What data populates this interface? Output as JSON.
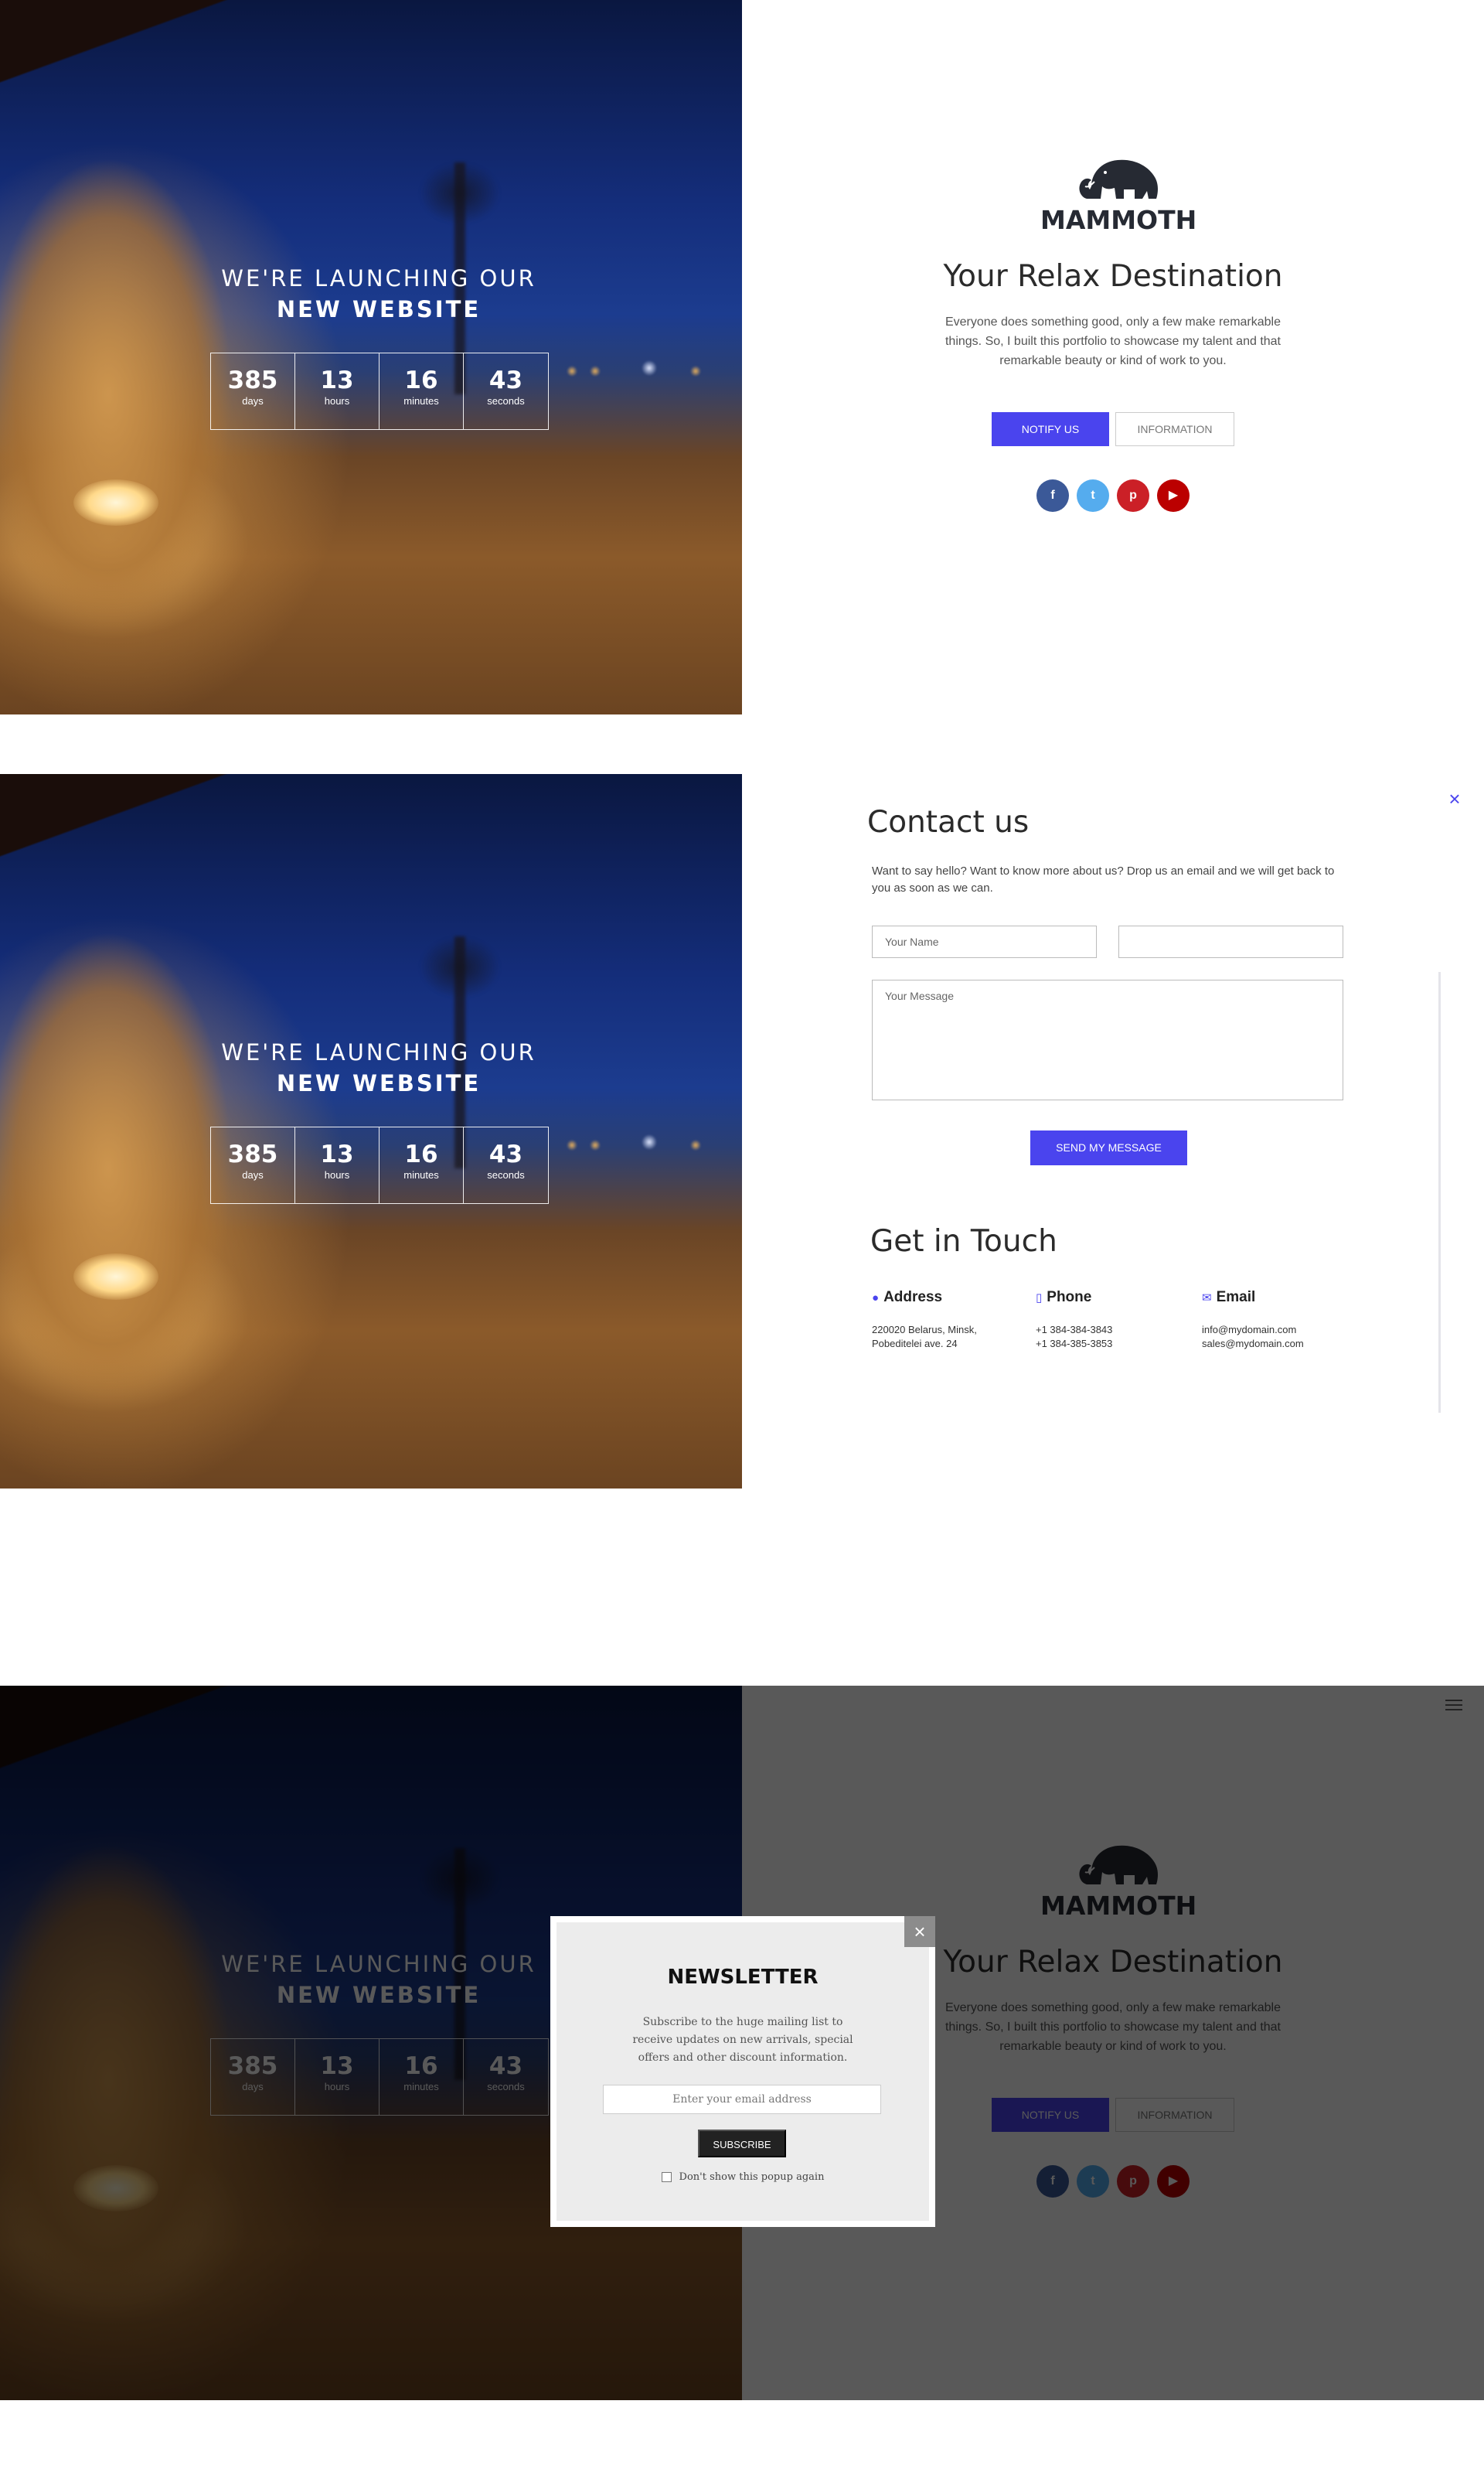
{
  "launch": {
    "line1": "WE'RE LAUNCHING OUR",
    "line2": "NEW WEBSITE"
  },
  "countdown": {
    "days": {
      "value": "385",
      "label": "days"
    },
    "hours": {
      "value": "13",
      "label": "hours"
    },
    "minutes": {
      "value": "16",
      "label": "minutes"
    },
    "seconds": {
      "value": "43",
      "label": "seconds"
    }
  },
  "landing": {
    "logo_text": "MAMMOTH",
    "tagline": "Your Relax Destination",
    "intro": "Everyone does something good, only a few make remarkable things. So, I built this portfolio to showcase my talent and that remarkable beauty or kind of work to you.",
    "notify_label": "NOTIFY US",
    "info_label": "INFORMATION",
    "socials": {
      "facebook": "f",
      "twitter": "t",
      "pinterest": "p",
      "youtube": "▶"
    }
  },
  "contact": {
    "close": "×",
    "title": "Contact us",
    "description": "Want to say hello? Want to know more about us? Drop us an email and we will get back to you as soon as we can.",
    "name_placeholder": "Your Name",
    "email_placeholder": "",
    "message_placeholder": "Your Message",
    "send_label": "SEND MY MESSAGE",
    "get_in_touch": "Get in Touch",
    "address": {
      "title": "Address",
      "line1": "220020 Belarus, Minsk,",
      "line2": "Pobeditelei ave. 24"
    },
    "phone": {
      "title": "Phone",
      "line1": "+1 384-384-3843",
      "line2": "+1 384-385-3853"
    },
    "email": {
      "title": "Email",
      "line1": "info@mydomain.com",
      "line2": "sales@mydomain.com"
    }
  },
  "newsletter": {
    "close": "×",
    "title": "NEWSLETTER",
    "text": "Subscribe to the huge mailing list to receive updates on new arrivals, special offers and other discount information.",
    "email_placeholder": "Enter your email address",
    "subscribe_label": "SUBSCRIBE",
    "dont_show": "Don't show this popup again"
  },
  "colors": {
    "accent": "#4a44ee",
    "facebook": "#3b5998",
    "twitter": "#55acee",
    "pinterest": "#cb2027",
    "youtube": "#bb0000"
  }
}
